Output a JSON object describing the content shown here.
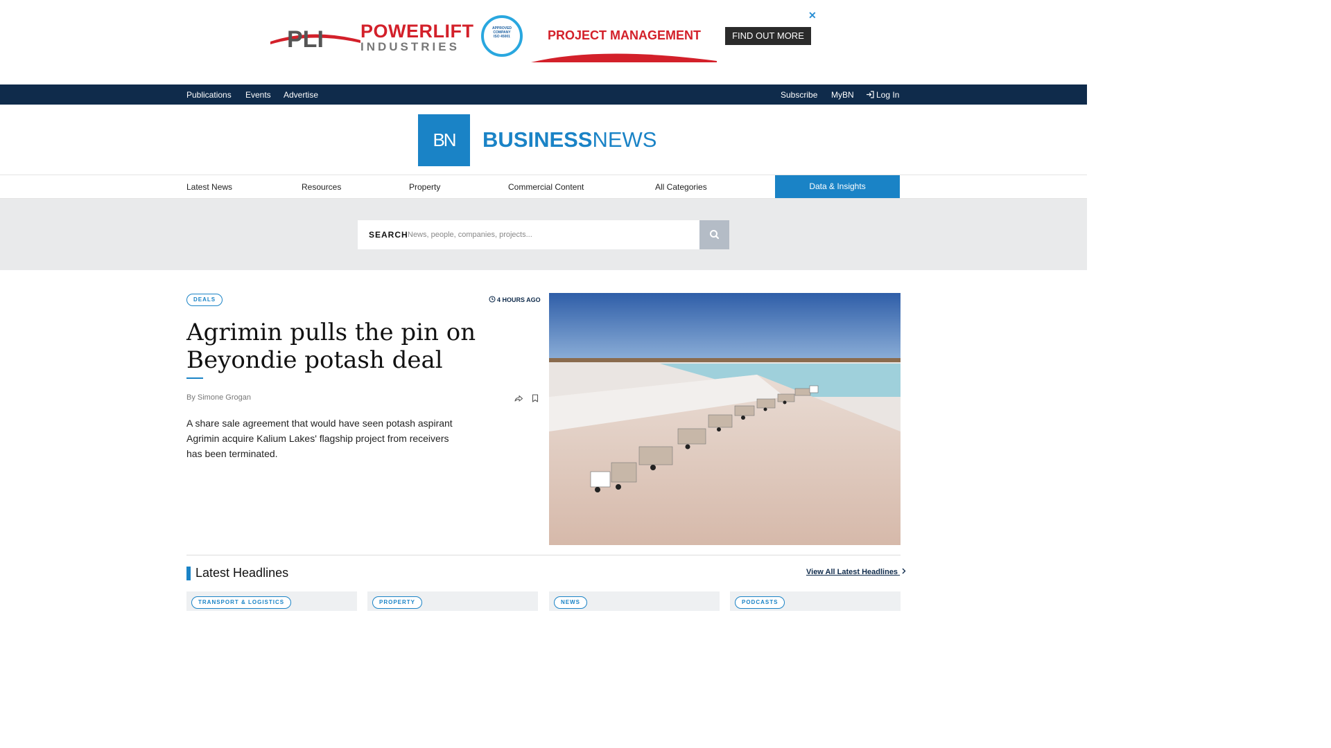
{
  "ad": {
    "brand_line1_a": "POWER",
    "brand_line1_b": "LIFT",
    "brand_line2": "INDUSTRIES",
    "logo_letters": "PLI",
    "badge_line1": "APPROVED",
    "badge_line2": "COMPANY",
    "badge_line3": "ISO 45001",
    "headline": "PROJECT MANAGEMENT",
    "cta": "FIND OUT MORE",
    "close": "✕"
  },
  "topbar": {
    "publications": "Publications",
    "events": "Events",
    "advertise": "Advertise",
    "subscribe": "Subscribe",
    "mybn": "MyBN",
    "login": "Log In"
  },
  "masthead": {
    "logo_box": "BN",
    "logo_bold": "BUSINESS",
    "logo_light": "NEWS"
  },
  "nav": {
    "latest_news": "Latest News",
    "resources": "Resources",
    "property": "Property",
    "commercial": "Commercial Content",
    "all_categories": "All Categories",
    "data_insights": "Data & Insights"
  },
  "search": {
    "label": "SEARCH",
    "placeholder": "News, people, companies, projects..."
  },
  "article": {
    "tag": "DEALS",
    "time": "4 HOURS AGO",
    "headline": "Agrimin pulls the pin on Beyondie potash deal",
    "by": "By",
    "author": "Simone Grogan",
    "summary": "A share sale agreement that would have seen potash aspirant Agrimin acquire Kalium Lakes' flagship project from receivers has been terminated."
  },
  "latest": {
    "title": "Latest Headlines",
    "view_all": "View All Latest Headlines",
    "cards": [
      {
        "tag": "TRANSPORT & LOGISTICS"
      },
      {
        "tag": "PROPERTY"
      },
      {
        "tag": "NEWS"
      },
      {
        "tag": "PODCASTS"
      }
    ]
  },
  "colors": {
    "brand_blue": "#1a83c6",
    "navy": "#0f2b4b",
    "ad_red": "#d3202a"
  }
}
